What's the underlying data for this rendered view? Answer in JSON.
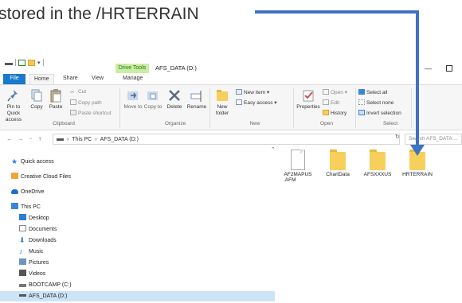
{
  "caption": {
    "text": "stored in the /HRTERRAIN"
  },
  "colors": {
    "arrow": "#3e73c0",
    "file_tab": "#1979ca",
    "context_tab": "#c9efa3",
    "folder": "#f7cf5b",
    "selected": "#cce4f7"
  },
  "titlebar": {
    "context_tab": "Drive Tools",
    "window_title": "AFS_DATA (D:)",
    "minimize": "—"
  },
  "tabs": {
    "file": "File",
    "home": "Home",
    "share": "Share",
    "view": "View",
    "manage": "Manage"
  },
  "ribbon": {
    "pin": "Pin to Quick access",
    "copy": "Copy",
    "paste": "Paste",
    "cut": "Cut",
    "copy_path": "Copy path",
    "paste_shortcut": "Paste shortcut",
    "move_to": "Move to",
    "copy_to": "Copy to",
    "delete": "Delete",
    "rename": "Rename",
    "new_folder": "New folder",
    "new_item": "New item",
    "easy_access": "Easy access",
    "properties": "Properties",
    "open": "Open",
    "edit": "Edit",
    "history": "History",
    "select_all": "Select all",
    "select_none": "Select none",
    "invert_selection": "Invert selection",
    "groups": {
      "clipboard": "Clipboard",
      "organize": "Organize",
      "new": "New",
      "open": "Open",
      "select": "Select"
    }
  },
  "address": {
    "back": "←",
    "forward": "→",
    "recent": "⌄",
    "up": "↑",
    "crumbs": [
      "This PC",
      "AFS_DATA (D:)"
    ],
    "search_placeholder": "Search AFS_DATA ..."
  },
  "nav": {
    "items": [
      {
        "label": "Quick access",
        "icon": "star-icon"
      },
      {
        "label": "Creative Cloud Files",
        "icon": "creative-cloud-icon"
      },
      {
        "label": "OneDrive",
        "icon": "cloud-icon"
      },
      {
        "label": "This PC",
        "icon": "computer-icon"
      },
      {
        "label": "Desktop",
        "icon": "desktop-icon"
      },
      {
        "label": "Documents",
        "icon": "documents-icon"
      },
      {
        "label": "Downloads",
        "icon": "download-icon"
      },
      {
        "label": "Music",
        "icon": "music-icon"
      },
      {
        "label": "Pictures",
        "icon": "pictures-icon"
      },
      {
        "label": "Videos",
        "icon": "videos-icon"
      },
      {
        "label": "BOOTCAMP (C:)",
        "icon": "drive-icon"
      },
      {
        "label": "AFS_DATA (D:)",
        "icon": "drive-icon"
      }
    ]
  },
  "files": [
    {
      "name_line1": "AF2MAPUS",
      "name_line2": ".AFM",
      "type": "file"
    },
    {
      "name_line1": "ChartData",
      "name_line2": "",
      "type": "folder"
    },
    {
      "name_line1": "AFSXXXUS",
      "name_line2": "",
      "type": "folder"
    },
    {
      "name_line1": "HRTERRAIN",
      "name_line2": "",
      "type": "folder"
    }
  ]
}
